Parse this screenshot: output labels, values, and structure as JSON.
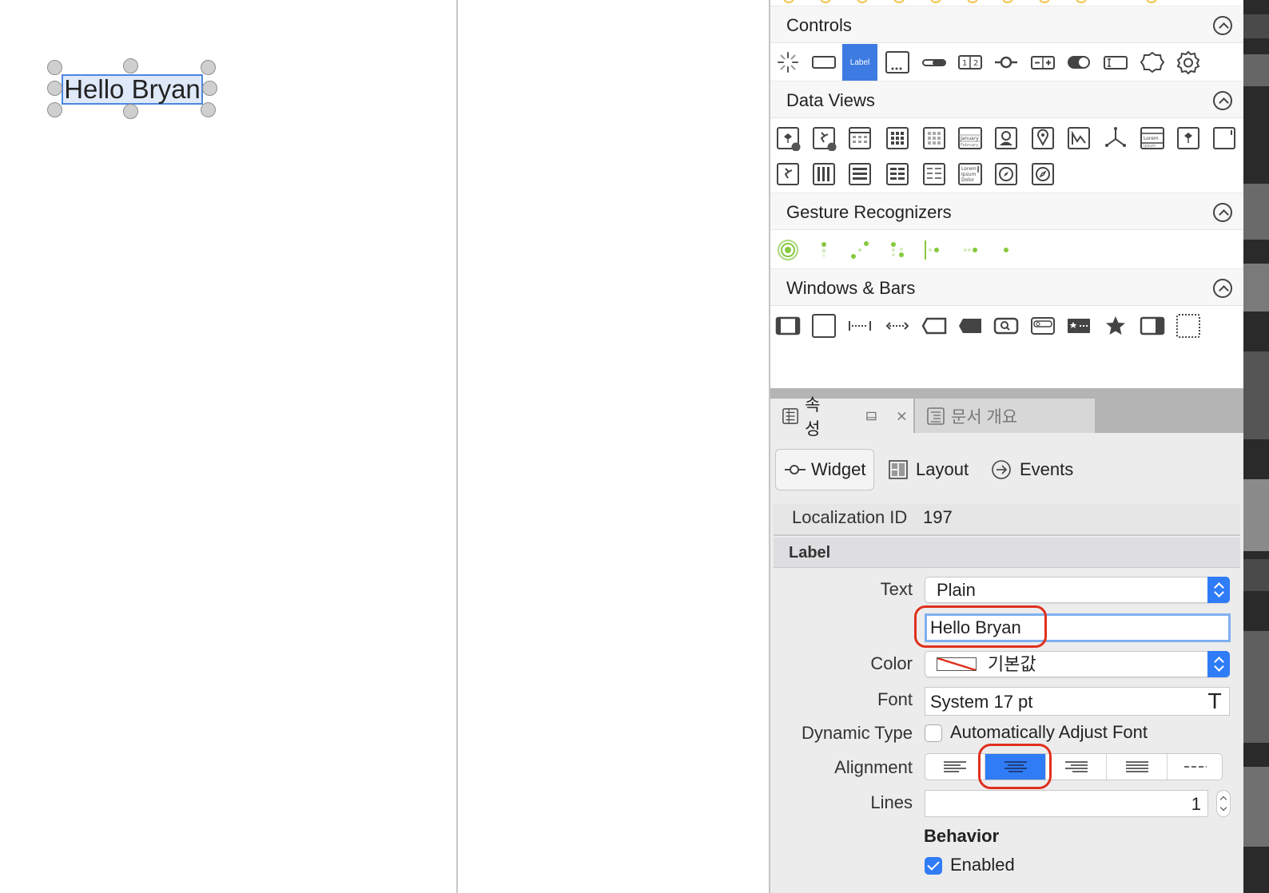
{
  "canvas": {
    "label_text": "Hello Bryan"
  },
  "palette": {
    "sections": [
      {
        "title": "Controls",
        "icons": [
          "activity-indicator-icon",
          "button-icon",
          "label-icon",
          "text-field-icon",
          "slider-icon",
          "segmented-control-icon",
          "slider-thumb-icon",
          "stepper-icon",
          "switch-icon",
          "text-input-icon",
          "custom-shape-icon",
          "gear-shape-icon"
        ],
        "label_icon_text": "Label"
      },
      {
        "title": "Data Views",
        "icons_row1": [
          "ar-scene-icon",
          "ar-sprite-icon",
          "table-view-icon",
          "grid-view-icon",
          "collection-view-icon",
          "date-picker-icon",
          "image-view-icon",
          "map-view-icon",
          "chart-view-icon",
          "scene-3d-icon",
          "text-view-icon",
          "spritekit-view-icon",
          "container-view-icon"
        ],
        "icons_row2": [
          "sprite-view-icon",
          "column-view-icon",
          "list-view-icon",
          "grid-list-icon",
          "detail-list-icon",
          "lorem-text-icon",
          "compass-view-icon",
          "navigation-view-icon"
        ],
        "date_picker_text": [
          "January",
          "February"
        ],
        "text_view_text": [
          "Lorem",
          "Ipsum"
        ],
        "lorem_text": [
          "Lorem",
          "Ipsum",
          "Dolor"
        ]
      },
      {
        "title": "Gesture Recognizers",
        "icons": [
          "tap-gesture-icon",
          "pinch-gesture-icon",
          "rotation-gesture-icon",
          "swipe-gesture-icon",
          "edge-pan-gesture-icon",
          "pan-gesture-icon",
          "long-press-gesture-icon"
        ]
      },
      {
        "title": "Windows & Bars",
        "icons": [
          "navigation-bar-icon",
          "view-icon",
          "flexible-space-icon",
          "fixed-space-icon",
          "toolbar-item-icon",
          "tab-bar-icon",
          "search-bar-icon",
          "search-field-icon",
          "tab-bar-item-icon",
          "star-item-icon",
          "split-view-icon",
          "dashed-container-icon"
        ]
      }
    ]
  },
  "inspector": {
    "tabs": [
      {
        "label": "속성"
      },
      {
        "label": "문서 개요"
      }
    ],
    "subtabs": [
      {
        "label": "Widget"
      },
      {
        "label": "Layout"
      },
      {
        "label": "Events"
      }
    ],
    "localization_id": {
      "label": "Localization ID",
      "value": "197"
    },
    "section_title": "Label",
    "text": {
      "label": "Text",
      "type_value": "Plain",
      "content": "Hello Bryan"
    },
    "color": {
      "label": "Color",
      "value": "기본값"
    },
    "font": {
      "label": "Font",
      "value": "System 17 pt",
      "icon_glyph": "T"
    },
    "dynamic_type": {
      "label": "Dynamic Type",
      "option": "Automatically Adjust Font",
      "checked": false
    },
    "alignment": {
      "label": "Alignment",
      "options": [
        "left",
        "center",
        "right",
        "justified",
        "natural"
      ],
      "selected": "center"
    },
    "lines": {
      "label": "Lines",
      "value": "1"
    },
    "behavior": {
      "title": "Behavior",
      "enabled_label": "Enabled",
      "enabled": true
    }
  },
  "colors": {
    "accent": "#2f7cf6",
    "highlight_ring": "#e0301e",
    "selection_border": "#4c86e0",
    "gesture_green": "#86c93e"
  }
}
